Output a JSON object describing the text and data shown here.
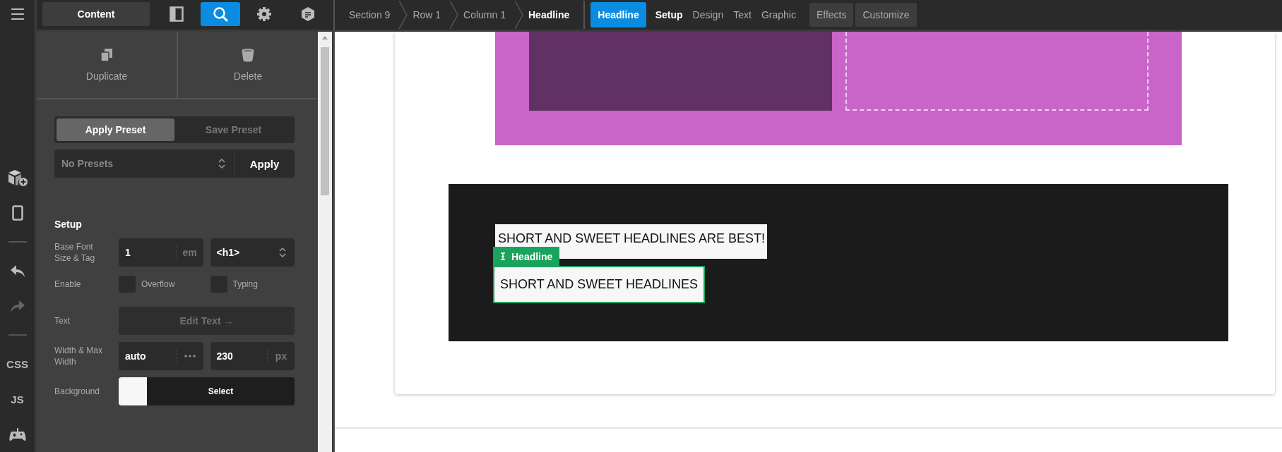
{
  "rail": {
    "items": [
      {
        "kind": "menu"
      },
      {
        "kind": "add-element"
      },
      {
        "kind": "mobile"
      },
      {
        "kind": "separator"
      },
      {
        "kind": "undo",
        "disabled": false
      },
      {
        "kind": "redo",
        "disabled": true
      },
      {
        "kind": "separator"
      },
      {
        "kind": "text",
        "label": "CSS"
      },
      {
        "kind": "text",
        "label": "JS"
      },
      {
        "kind": "gamepad"
      }
    ]
  },
  "toolbar": {
    "content_button": "Content",
    "tools": [
      {
        "kind": "panel",
        "selected": false
      },
      {
        "kind": "search",
        "selected": true
      },
      {
        "kind": "settings",
        "selected": false
      },
      {
        "kind": "notes",
        "selected": false
      }
    ]
  },
  "actions": [
    {
      "kind": "duplicate",
      "label": "Duplicate"
    },
    {
      "kind": "delete",
      "label": "Delete"
    }
  ],
  "preset_tabs": [
    {
      "label": "Apply Preset",
      "selected": true
    },
    {
      "label": "Save Preset",
      "selected": false
    }
  ],
  "preset_select": {
    "placeholder": "No Presets"
  },
  "apply_button": "Apply",
  "setup": {
    "title": "Setup",
    "rows": [
      {
        "kind": "fields",
        "label": "Base Font Size & Tag",
        "fields": [
          {
            "kind": "unit",
            "value": "1",
            "unit": "em"
          },
          {
            "kind": "select",
            "value": "<h1>"
          }
        ]
      },
      {
        "kind": "checks",
        "label": "Enable",
        "checks": [
          {
            "label": "Overflow",
            "checked": false
          },
          {
            "label": "Typing",
            "checked": false
          }
        ]
      },
      {
        "kind": "button",
        "label": "Text",
        "button": "Edit Text →",
        "disabled": true
      },
      {
        "kind": "fields",
        "label": "Width & Max Width",
        "fields": [
          {
            "kind": "more",
            "value": "auto"
          },
          {
            "kind": "unit",
            "value": "230",
            "unit": "px"
          }
        ]
      },
      {
        "kind": "color",
        "label": "Background",
        "color": "#f7f7f7",
        "button": "Select"
      }
    ]
  },
  "breadcrumbs": [
    {
      "label": "Section 9",
      "selected": false
    },
    {
      "label": "Row 1",
      "selected": false
    },
    {
      "label": "Column 1",
      "selected": false
    },
    {
      "label": "Headline",
      "selected": true
    }
  ],
  "element_tabs": [
    {
      "kind": "element",
      "label": "Headline"
    },
    {
      "kind": "tab",
      "label": "Setup",
      "selected": true
    },
    {
      "kind": "tab",
      "label": "Design",
      "selected": false
    },
    {
      "kind": "tab",
      "label": "Text",
      "selected": false
    },
    {
      "kind": "tab",
      "label": "Graphic",
      "selected": false
    },
    {
      "kind": "boxed",
      "label": "Effects"
    },
    {
      "kind": "boxed",
      "label": "Customize"
    }
  ],
  "canvas": {
    "headlines": [
      {
        "text": "SHORT AND SWEET HEADLINES ARE BEST!",
        "selected": false
      },
      {
        "text": "SHORT AND SWEET HEADLINES",
        "selected": true,
        "tag": "Headline"
      }
    ]
  }
}
